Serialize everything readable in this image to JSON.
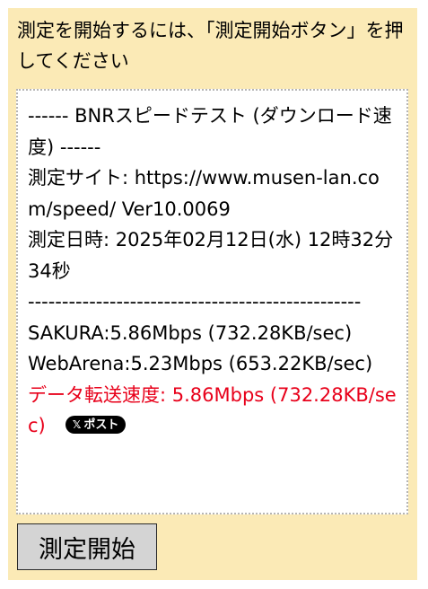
{
  "instruction": "測定を開始するには、「測定開始ボタン」を押してください",
  "result": {
    "header": "------ BNRスピードテスト (ダウンロード速度) ------",
    "site": "測定サイト: https://www.musen-lan.com/speed/ Ver10.0069",
    "datetime": "測定日時: 2025年02月12日(水) 12時32分34秒",
    "separator": "-------------------------------------------------",
    "sakura": "SAKURA:5.86Mbps (732.28KB/sec)",
    "webarena": "WebArena:5.23Mbps (653.22KB/sec)",
    "transfer_speed": "データ転送速度: 5.86Mbps (732.28KB/sec)"
  },
  "share": {
    "icon": "x-logo-icon",
    "label": "ポスト"
  },
  "start_button": {
    "label": "測定開始"
  },
  "colors": {
    "panel_background": "#fbeab6",
    "highlight_text": "#e8001a",
    "button_background": "#d4d4d4"
  }
}
